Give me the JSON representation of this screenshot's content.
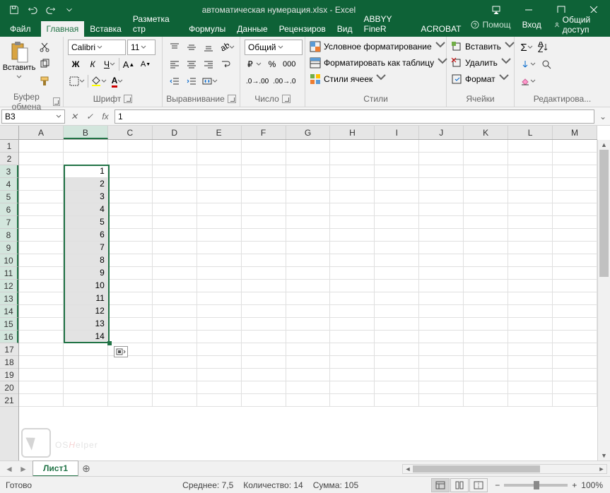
{
  "title": "автоматическая нумерация.xlsx - Excel",
  "tabs": {
    "file": "Файл",
    "home": "Главная",
    "insert": "Вставка",
    "layout": "Разметка стр",
    "formulas": "Формулы",
    "data": "Данные",
    "review": "Рецензиров",
    "view": "Вид",
    "abbyy": "ABBYY FineR",
    "acrobat": "ACROBAT",
    "tell": "Помощ",
    "signin": "Вход",
    "share": "Общий доступ"
  },
  "ribbon": {
    "clipboard": {
      "paste": "Вставить",
      "label": "Буфер обмена"
    },
    "font": {
      "name": "Calibri",
      "size": "11",
      "bold": "Ж",
      "italic": "К",
      "underline": "Ч",
      "label": "Шрифт"
    },
    "align": {
      "label": "Выравнивание"
    },
    "number": {
      "format": "Общий",
      "label": "Число"
    },
    "styles": {
      "cond": "Условное форматирование",
      "table": "Форматировать как таблицу",
      "cell": "Стили ячеек",
      "label": "Стили"
    },
    "cells": {
      "insert": "Вставить",
      "delete": "Удалить",
      "format": "Формат",
      "label": "Ячейки"
    },
    "editing": {
      "label": "Редактирова..."
    }
  },
  "namebox": "B3",
  "formula": "1",
  "columns": [
    "A",
    "B",
    "C",
    "D",
    "E",
    "F",
    "G",
    "H",
    "I",
    "J",
    "K",
    "L",
    "M"
  ],
  "rows": [
    "1",
    "2",
    "3",
    "4",
    "5",
    "6",
    "7",
    "8",
    "9",
    "10",
    "11",
    "12",
    "13",
    "14",
    "15",
    "16",
    "17",
    "18",
    "19",
    "20",
    "21"
  ],
  "data": {
    "B": {
      "3": "1",
      "4": "2",
      "5": "3",
      "6": "4",
      "7": "5",
      "8": "6",
      "9": "7",
      "10": "8",
      "11": "9",
      "12": "10",
      "13": "11",
      "14": "12",
      "15": "13",
      "16": "14"
    }
  },
  "selection": {
    "col": "B",
    "rowStart": 3,
    "rowEnd": 16
  },
  "sheet": "Лист1",
  "status": {
    "ready": "Готово",
    "avg_l": "Среднее:",
    "avg_v": "7,5",
    "cnt_l": "Количество:",
    "cnt_v": "14",
    "sum_l": "Сумма:",
    "sum_v": "105",
    "zoom": "100%"
  },
  "wm": {
    "os": "OS",
    "h": "H",
    "elper": "elper"
  }
}
